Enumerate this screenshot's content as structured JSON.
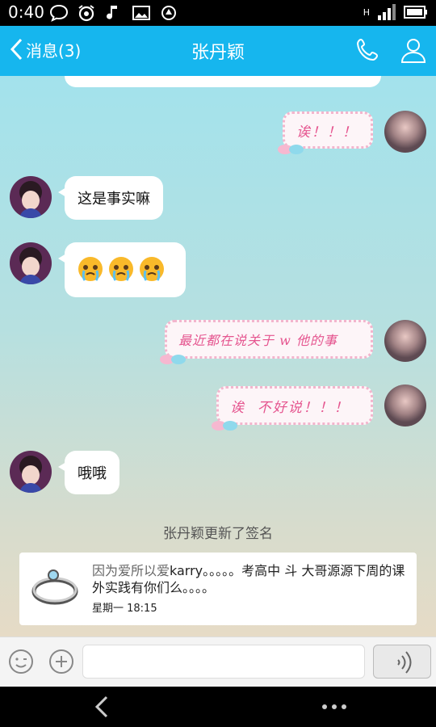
{
  "status_bar": {
    "time": "0:40",
    "network": "H"
  },
  "header": {
    "back_label": "消息(3)",
    "title": "张丹颖"
  },
  "messages": [
    {
      "side": "right",
      "text": "诶！！！"
    },
    {
      "side": "left",
      "text": "这是事实嘛"
    },
    {
      "side": "left",
      "type": "emoji",
      "emoji_name": "crying-face-emoji",
      "count": 3
    },
    {
      "side": "right",
      "text": "最近都在说关于 w 他的事"
    },
    {
      "side": "right",
      "text": "诶  不好说！！！"
    },
    {
      "side": "left",
      "text": "哦哦"
    }
  ],
  "system_message": "张丹颖更新了签名",
  "signature_card": {
    "prefix": "因为爱所以爱",
    "text": "karry。。。。。考高中 斗 大哥源源下周的课外实践有你们么。。。。",
    "time": "星期一 18:15"
  },
  "colors": {
    "header": "#16b6ee",
    "pink_text": "#e5558f"
  }
}
